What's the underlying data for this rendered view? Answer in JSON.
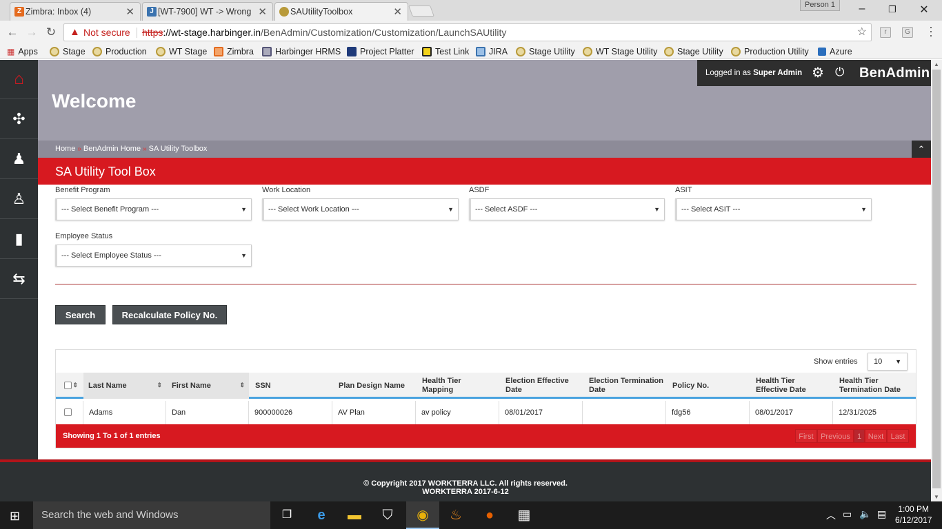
{
  "browser": {
    "tabs": [
      {
        "title": "Zimbra: Inbox (4)",
        "icon": "zimbra-icon",
        "color": "#e46b1f"
      },
      {
        "title": "[WT-7900] WT -> Wrong",
        "icon": "jira-icon",
        "color": "#3b73af"
      },
      {
        "title": "SAUtilityToolbox",
        "icon": "site-icon",
        "color": "#b89a3a"
      }
    ],
    "profile": "Person 1",
    "security_label": "Not secure",
    "url_scheme": "https",
    "url_host": "://wt-stage.harbinger.in",
    "url_path": "/BenAdmin/Customization/Customization/LaunchSAUtility",
    "bookmarks": [
      "Apps",
      "Stage",
      "Production",
      "WT Stage",
      "Zimbra",
      "Harbinger HRMS",
      "Project Platter",
      "Test Link",
      "JIRA",
      "Stage Utility",
      "WT Stage Utility",
      "Stage Utility",
      "Production Utility",
      "Azure"
    ]
  },
  "header": {
    "welcome": "Welcome",
    "logged_in_prefix": "Logged in as ",
    "user": "Super Admin",
    "brand": "BenAdmin"
  },
  "breadcrumb": [
    "Home",
    "BenAdmin Home",
    "SA Utility Toolbox"
  ],
  "page_title": "SA Utility Tool Box",
  "filters": [
    {
      "label": "Benefit Program",
      "value": "--- Select Benefit Program ---"
    },
    {
      "label": "Work Location",
      "value": "--- Select Work Location ---"
    },
    {
      "label": "ASDF",
      "value": "--- Select ASDF ---"
    },
    {
      "label": "ASIT",
      "value": "--- Select ASIT ---"
    },
    {
      "label": "Employee Status",
      "value": "--- Select Employee Status ---"
    }
  ],
  "buttons": {
    "search": "Search",
    "recalculate": "Recalculate Policy No."
  },
  "table": {
    "show_entries_label": "Show entries",
    "page_size": "10",
    "columns": [
      "Last Name",
      "First Name",
      "SSN",
      "Plan Design Name",
      "Health Tier Mapping",
      "Election Effective Date",
      "Election Termination Date",
      "Policy No.",
      "Health Tier Effective Date",
      "Health Tier Termination Date"
    ],
    "rows": [
      [
        "Adams",
        "Dan",
        "900000026",
        "AV Plan",
        "av policy",
        "08/01/2017",
        "",
        "fdg56",
        "08/01/2017",
        "12/31/2025"
      ]
    ],
    "info": "Showing 1 To 1 of 1 entries",
    "pagination": {
      "first": "First",
      "previous": "Previous",
      "current": "1",
      "next": "Next",
      "last": "Last"
    }
  },
  "footer": {
    "copyright": "© Copyright 2017 WORKTERRA LLC. All rights reserved.",
    "version": "WORKTERRA 2017-6-12"
  },
  "taskbar": {
    "search_placeholder": "Search the web and Windows",
    "time": "1:00 PM",
    "date": "6/12/2017"
  },
  "colors": {
    "accent_red": "#d71920",
    "header_gray": "#a09eab",
    "sidebar": "#2d3133"
  }
}
